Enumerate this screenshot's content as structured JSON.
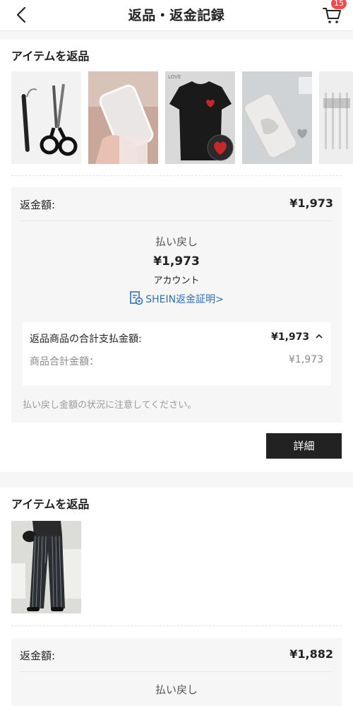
{
  "header": {
    "title": "返品・返金記録",
    "cart_count": "15"
  },
  "section1": {
    "title": "アイテムを返品",
    "thumbs": [
      "tweezers-scissors",
      "clear-phone-case",
      "black-heart-tee",
      "silver-pouch",
      "brush-set"
    ],
    "refund_label": "返金額:",
    "refund_amount": "¥1,973",
    "refund_method": "払い戻し",
    "refund_value": "¥1,973",
    "account": "アカウント",
    "certificate_link": "SHEIN返金証明>",
    "summary_label": "返品商品の合計支払金額:",
    "summary_amount": "¥1,973",
    "item_total_label": "商品合計金額：",
    "item_total_amount": "¥1,973",
    "notice": "払い戻し金額の状況に注意してください。",
    "detail_button": "詳細"
  },
  "section2": {
    "title": "アイテムを返品",
    "refund_label": "返金額:",
    "refund_amount": "¥1,882",
    "refund_method": "払い戻し"
  }
}
